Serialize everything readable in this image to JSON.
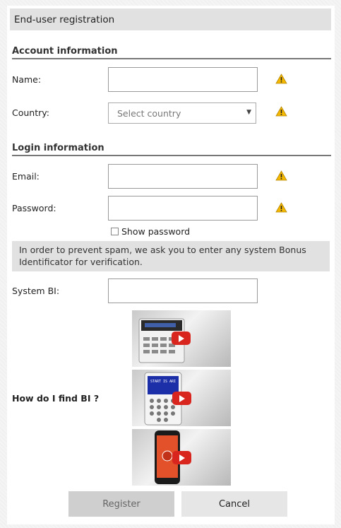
{
  "header": {
    "title": "End-user registration"
  },
  "account_section": {
    "title": "Account information",
    "name_label": "Name:",
    "name_value": "",
    "country_label": "Country:",
    "country_placeholder": "Select country"
  },
  "login_section": {
    "title": "Login information",
    "email_label": "Email:",
    "email_value": "",
    "password_label": "Password:",
    "password_value": "",
    "show_password_label": "Show password",
    "show_password_checked": false
  },
  "verification": {
    "notice": "In order to prevent spam, we ask you to enter any system Bonus Identificator for verification.",
    "system_bi_label": "System BI:",
    "system_bi_value": "",
    "help_label": "How do I find BI ?",
    "videos": [
      {
        "icon": "keypad-lcd-video-thumbnail",
        "screen_text": ""
      },
      {
        "icon": "keypad-blue-screen-video-thumbnail",
        "screen_text": "START IS ARI"
      },
      {
        "icon": "smartphone-app-video-thumbnail",
        "screen_text": ""
      }
    ]
  },
  "buttons": {
    "register": "Register",
    "cancel": "Cancel"
  },
  "colors": {
    "header_bg": "#e1e1e1",
    "warning": "#f5b800",
    "play_button": "#d8251e",
    "register_bg": "#cfcfcf",
    "cancel_bg": "#e6e6e6"
  }
}
